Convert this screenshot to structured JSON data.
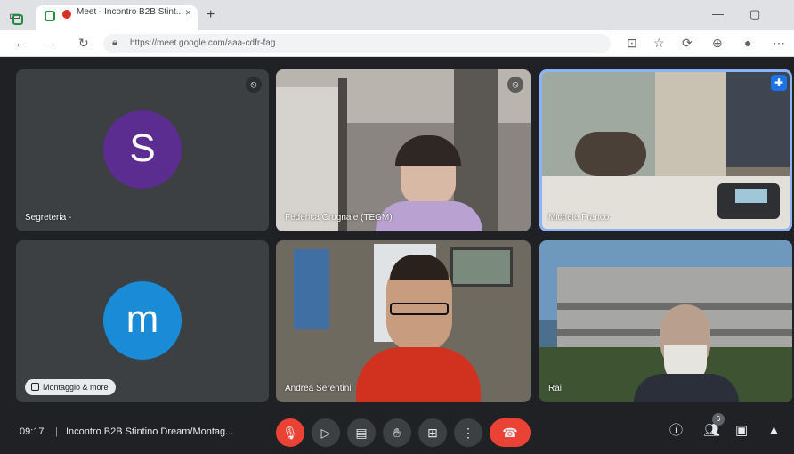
{
  "browser": {
    "tab": {
      "title": "Meet - Incontro B2B Stint...",
      "close_glyph": "×"
    },
    "new_tab_glyph": "+",
    "window_controls": {
      "minimize": "—",
      "restore": "▢"
    },
    "address_bar": {
      "url": "https://meet.google.com/aaa-cdfr-fag"
    },
    "icons": [
      "sidebar-icon",
      "back-icon",
      "forward-icon",
      "refresh-icon",
      "lock-icon",
      "read-aloud-icon",
      "favorites-icon",
      "extensions-icon",
      "collections-icon",
      "profile-icon",
      "more-icon"
    ]
  },
  "participants": [
    {
      "name": "Segreteria -",
      "avatar_letter": "S",
      "avatar_color": "#5c2d91",
      "muted": true
    },
    {
      "name": "Federica Crognale (TEGM)",
      "muted": true
    },
    {
      "name": "Michele Franco",
      "pinned": true
    },
    {
      "name": "",
      "avatar_letter": "m",
      "avatar_color": "#1a8bd6",
      "pill_label": "Montaggio & more"
    },
    {
      "name": "Andrea Serentini"
    },
    {
      "name": "Rai"
    }
  ],
  "controls": {
    "clock": "09:17",
    "separator": "|",
    "meeting_title": "Incontro B2B Stintino Dream/Montag...",
    "mic": "mic-off-icon",
    "camera": "camera-icon",
    "captions": "captions-icon",
    "raise_hand": "raise-hand-icon",
    "present": "present-icon",
    "more": "more-options-icon",
    "hangup": "hangup-icon",
    "right": [
      "info-icon",
      "people-icon",
      "chat-icon",
      "activities-icon"
    ],
    "people_badge": "6"
  },
  "colors": {
    "accent": "#8ab4f8",
    "hangup": "#ea4335",
    "bg": "#202124"
  }
}
